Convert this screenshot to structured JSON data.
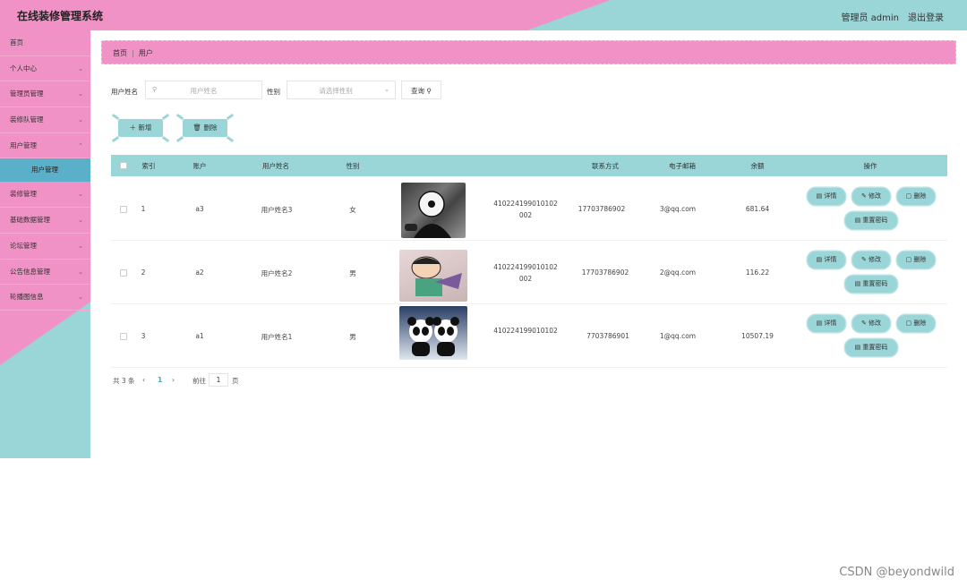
{
  "header": {
    "title": "在线装修管理系统",
    "user": "管理员 admin",
    "logout": "退出登录"
  },
  "sidebar": {
    "items": [
      {
        "label": "首页"
      },
      {
        "label": "个人中心"
      },
      {
        "label": "管理员管理"
      },
      {
        "label": "装修队管理"
      },
      {
        "label": "用户管理"
      },
      {
        "label": "装修管理"
      },
      {
        "label": "基础数据管理"
      },
      {
        "label": "论坛管理"
      },
      {
        "label": "公告信息管理"
      },
      {
        "label": "轮播图信息"
      }
    ],
    "active_sub": "用户管理"
  },
  "breadcrumb": {
    "home": "首页",
    "current": "用户"
  },
  "search": {
    "name_label": "用户姓名",
    "name_placeholder": "用户姓名",
    "gender_label": "性别",
    "gender_placeholder": "请选择性别",
    "query_button": "查询"
  },
  "actions": {
    "add": "新增",
    "delete": "删除"
  },
  "table": {
    "headers": [
      "索引",
      "账户",
      "用户姓名",
      "性别",
      "联系方式",
      "电子邮箱",
      "余额",
      "操作"
    ],
    "rows": [
      {
        "index": "1",
        "account": "a3",
        "name": "用户姓名3",
        "gender": "女",
        "id_line1": "410224199010102",
        "id_line2": "002",
        "phone": "17703786902",
        "email": "3@qq.com",
        "balance": "681.64"
      },
      {
        "index": "2",
        "account": "a2",
        "name": "用户姓名2",
        "gender": "男",
        "id_line1": "410224199010102",
        "id_line2": "002",
        "phone": "17703786902",
        "email": "2@qq.com",
        "balance": "116.22"
      },
      {
        "index": "3",
        "account": "a1",
        "name": "用户姓名1",
        "gender": "男",
        "id_line1": "410224199010102",
        "id_line2": "",
        "phone": "7703786901",
        "email": "1@qq.com",
        "balance": "10507.19"
      }
    ],
    "ops": {
      "detail": "详情",
      "edit": "修改",
      "delete": "删除",
      "reset": "重置密码"
    }
  },
  "pagination": {
    "total": "共 3 条",
    "current": "1",
    "goto": "前往",
    "page_input": "1",
    "page_unit": "页"
  },
  "watermark": "CSDN @beyondwild",
  "colors": {
    "pink": "#f192c6",
    "teal": "#9ad5d8",
    "active_blue": "#5aafc9"
  }
}
